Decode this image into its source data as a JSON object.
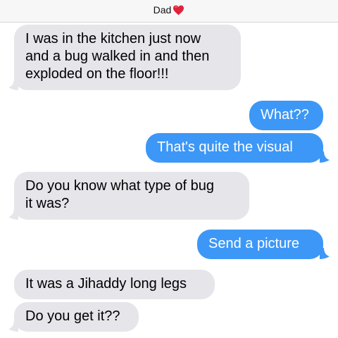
{
  "header": {
    "contact_name": "Dad",
    "heart_icon": "red-heart-icon"
  },
  "colors": {
    "incoming_bubble": "#e5e5ea",
    "outgoing_bubble": "#3d97f6",
    "heart": "#e0223a"
  },
  "messages": [
    {
      "direction": "incoming",
      "lines": [
        "I was in the kitchen just now",
        "and a bug walked in and then",
        "exploded on the floor!!!"
      ]
    },
    {
      "direction": "outgoing",
      "lines": [
        "What??"
      ]
    },
    {
      "direction": "outgoing",
      "lines": [
        "That's quite the visual"
      ]
    },
    {
      "direction": "incoming",
      "lines": [
        "Do you know what type of bug",
        "it was?"
      ]
    },
    {
      "direction": "outgoing",
      "lines": [
        "Send a picture"
      ]
    },
    {
      "direction": "incoming",
      "lines": [
        "It was a Jihaddy long legs"
      ]
    },
    {
      "direction": "incoming",
      "lines": [
        "Do you get it??"
      ]
    }
  ]
}
